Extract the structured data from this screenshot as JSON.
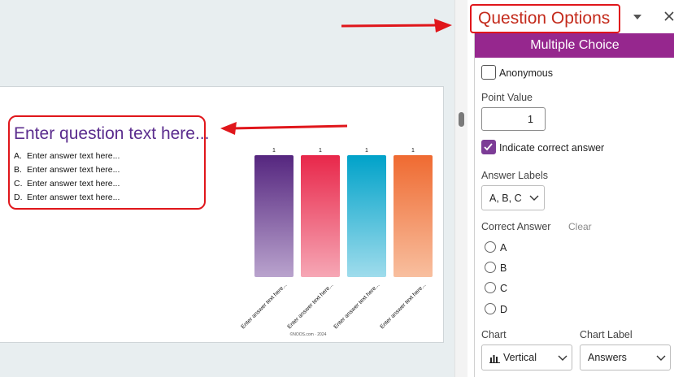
{
  "slide": {
    "question": "Enter question text here...",
    "answers": [
      {
        "letter": "A.",
        "text": "Enter answer text here..."
      },
      {
        "letter": "B.",
        "text": "Enter answer text here..."
      },
      {
        "letter": "C.",
        "text": "Enter answer text here..."
      },
      {
        "letter": "D.",
        "text": "Enter answer text here..."
      }
    ],
    "watermark": "©NOOS.com · 2024"
  },
  "chart_data": {
    "type": "bar",
    "categories": [
      "Enter answer text here...",
      "Enter answer text here...",
      "Enter answer text here...",
      "Enter answer text here..."
    ],
    "values": [
      1,
      1,
      1,
      1
    ],
    "data_labels": [
      "1",
      "1",
      "1",
      "1"
    ],
    "ylim": [
      0,
      1
    ],
    "grid": false,
    "legend": "none",
    "colors": [
      {
        "top": "#55267f",
        "bottom": "#b9a3cd"
      },
      {
        "top": "#e8274a",
        "bottom": "#f6a7b5"
      },
      {
        "top": "#00a2c9",
        "bottom": "#9fdcec"
      },
      {
        "top": "#ef6a31",
        "bottom": "#f8bf9f"
      }
    ]
  },
  "panel": {
    "title": "Question Options",
    "mode": "Multiple Choice",
    "anonymous_label": "Anonymous",
    "anonymous_checked": false,
    "point_value_label": "Point Value",
    "point_value": "1",
    "indicate_correct_label": "Indicate correct answer",
    "indicate_correct_checked": true,
    "answer_labels_label": "Answer Labels",
    "answer_labels_value": "A, B, C",
    "correct_answer_label": "Correct Answer",
    "clear_label": "Clear",
    "correct_options": [
      "A",
      "B",
      "C",
      "D"
    ],
    "chart_label": "Chart",
    "chart_value": "Vertical",
    "chart_label_label": "Chart Label",
    "chart_label_value": "Answers"
  },
  "colors": {
    "accent": "#96278e",
    "annotation_red": "#e0161b",
    "question_purple": "#5b2d8e"
  }
}
